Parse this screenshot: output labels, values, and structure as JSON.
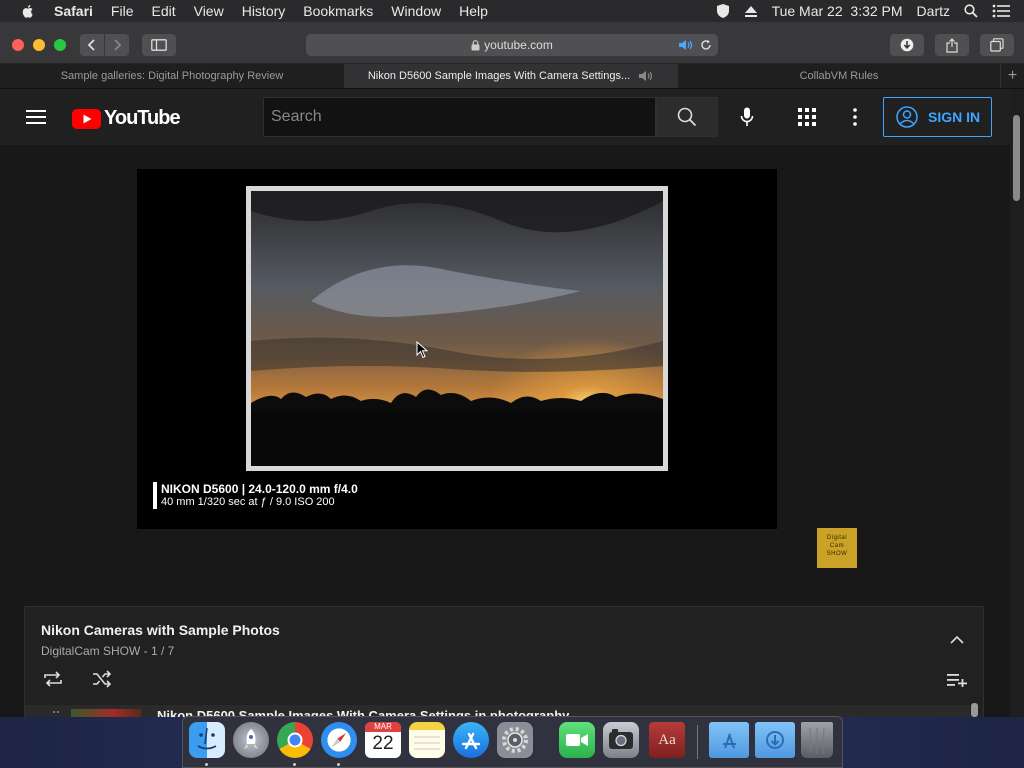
{
  "menubar": {
    "app_name": "Safari",
    "menus": [
      "File",
      "Edit",
      "View",
      "History",
      "Bookmarks",
      "Window",
      "Help"
    ],
    "datetime": "Tue Mar 22  3:32 PM",
    "user": "Dartz"
  },
  "browser": {
    "url": "youtube.com",
    "tabs": [
      {
        "title": "Sample galleries: Digital Photography Review",
        "active": false
      },
      {
        "title": "Nikon D5600 Sample Images With Camera Settings...",
        "active": true
      },
      {
        "title": "CollabVM Rules",
        "active": false
      }
    ],
    "new_tab_label": "+"
  },
  "youtube": {
    "logo_text": "YouTube",
    "search_placeholder": "Search",
    "sign_in_label": "SIGN IN",
    "video": {
      "caption_line1": "NIKON D5600 | 24.0-120.0 mm f/4.0",
      "caption_line2": "40 mm 1/320 sec at ƒ / 9.0 ISO 200"
    },
    "watermark": {
      "line1": "Digital",
      "line2": "Cam",
      "line3": "SHOW"
    },
    "playlist": {
      "title": "Nikon Cameras with Sample Photos",
      "subtitle": "DigitalCam SHOW - 1 / 7",
      "first_item": "Nikon D5600 Sample Images With Camera Settings in photography"
    }
  },
  "dock": {
    "apps": [
      "Finder",
      "Launchpad",
      "Chrome",
      "Safari",
      "Calendar",
      "Notes",
      "App Store",
      "System Preferences",
      "FaceTime",
      "Screenshot",
      "Dictionary",
      "Applications",
      "Downloads",
      "Trash"
    ],
    "calendar_month": "MAR",
    "calendar_day": "22",
    "dictionary_label": "Aa"
  },
  "colors": {
    "youtube_red": "#ff0000",
    "link_blue": "#3ea6ff",
    "watermark_gold": "#c9a227"
  }
}
